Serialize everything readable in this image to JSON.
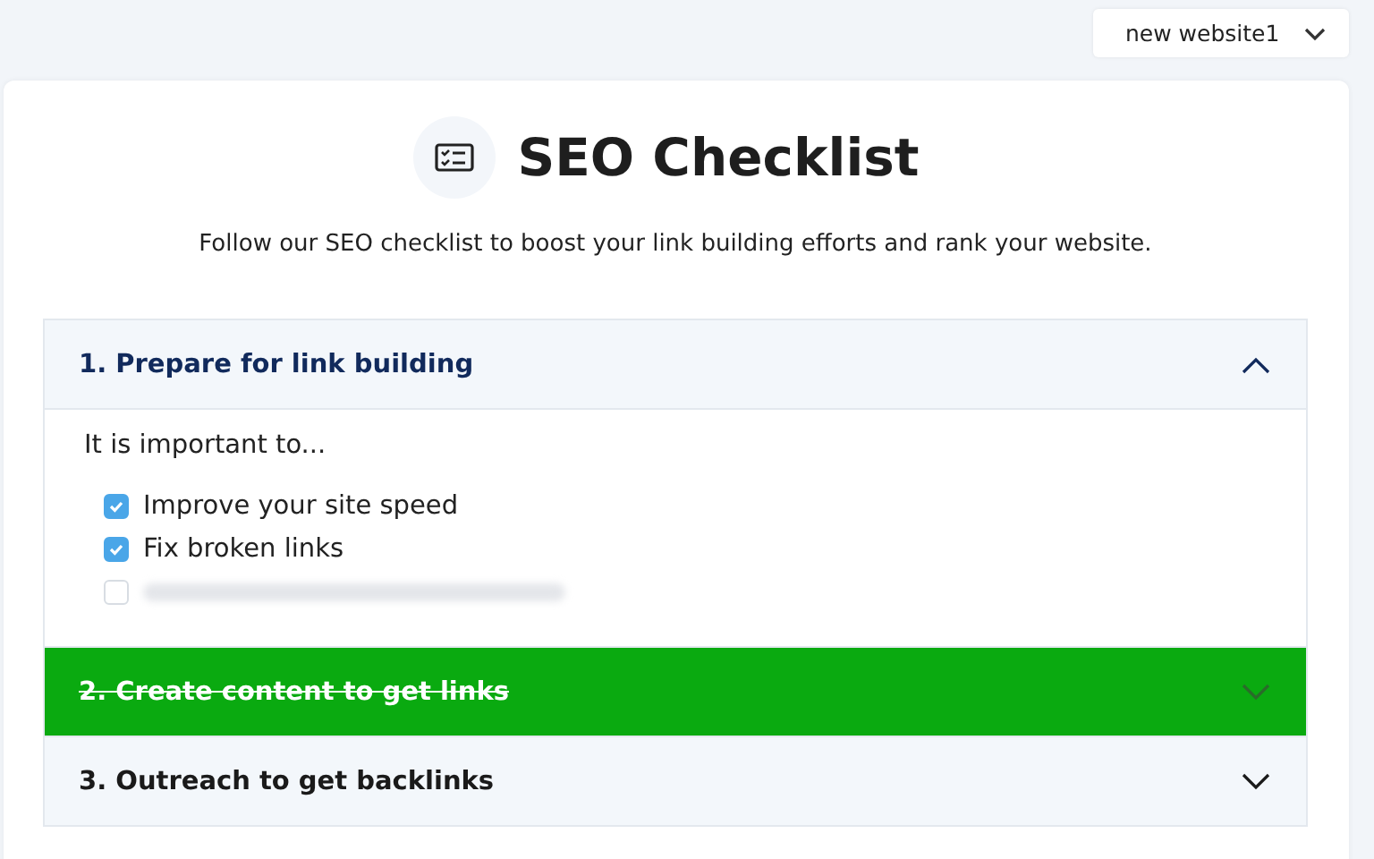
{
  "site_selector": {
    "value": "new website1"
  },
  "header": {
    "title": "SEO Checklist",
    "subtitle": "Follow our SEO checklist to boost your link building efforts and rank your website."
  },
  "sections": [
    {
      "title": "1. Prepare for link building",
      "expanded": true,
      "completed": false,
      "intro": "It is important to...",
      "items": [
        {
          "label": "Improve your site speed",
          "checked": true
        },
        {
          "label": "Fix broken links",
          "checked": true
        },
        {
          "kind": "blurred",
          "checked": false
        }
      ]
    },
    {
      "title": "2. Create content to get links",
      "expanded": false,
      "completed": true
    },
    {
      "title": "3. Outreach to get backlinks",
      "expanded": false,
      "completed": false
    }
  ]
}
